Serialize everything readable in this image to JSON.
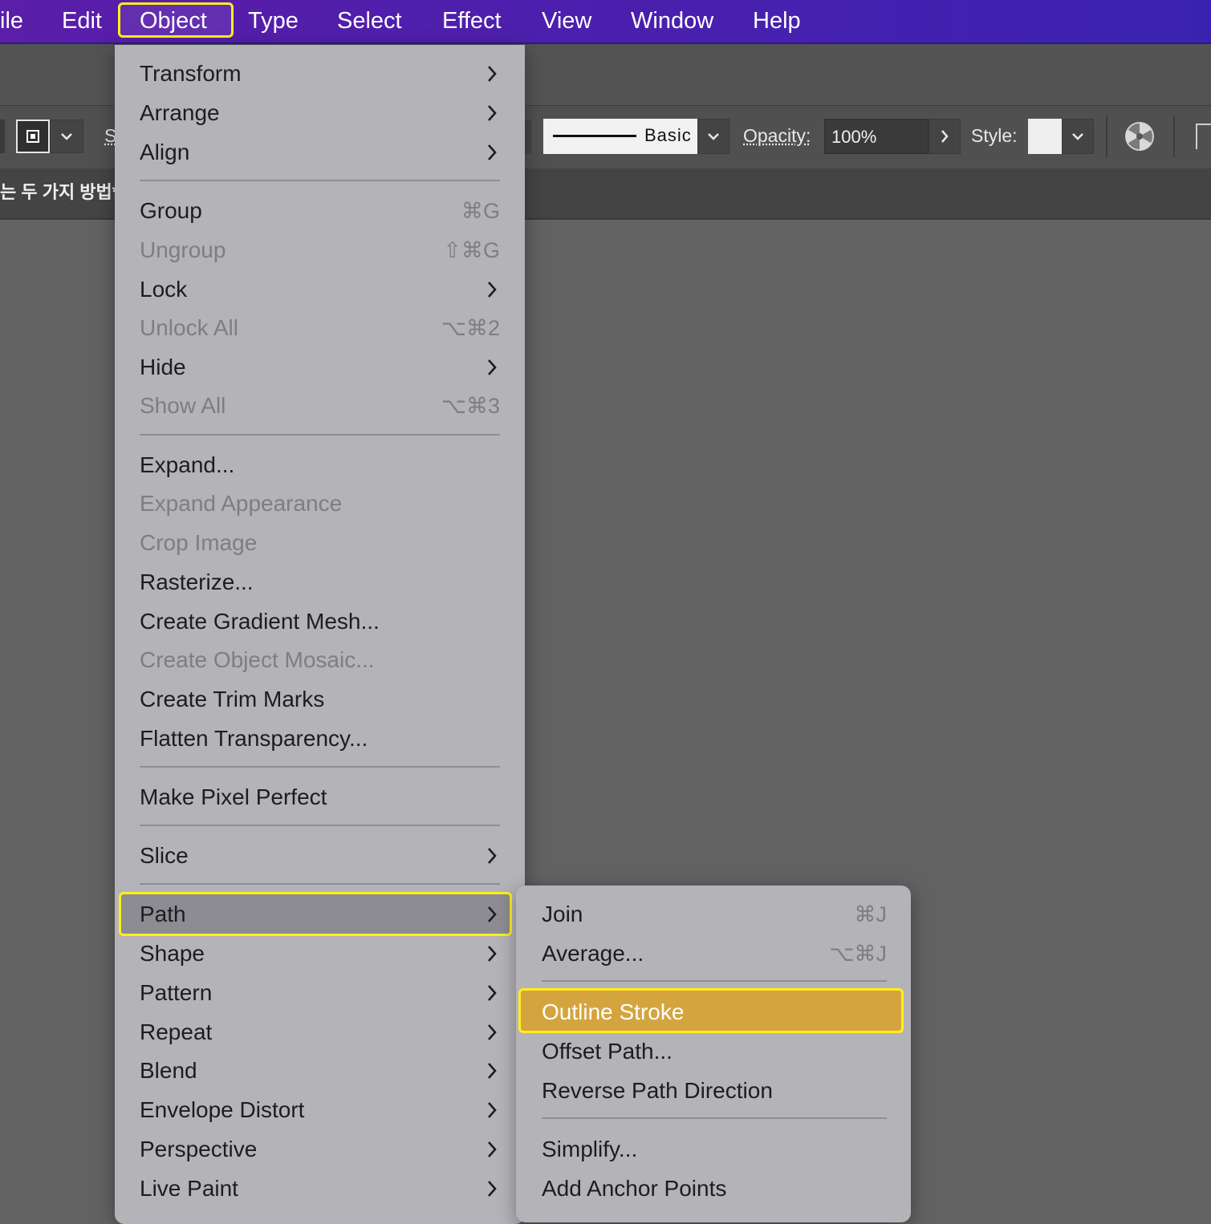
{
  "menubar": {
    "items": [
      {
        "label": "ile"
      },
      {
        "label": "Edit"
      },
      {
        "label": "Object"
      },
      {
        "label": "Type"
      },
      {
        "label": "Select"
      },
      {
        "label": "Effect"
      },
      {
        "label": "View"
      },
      {
        "label": "Window"
      },
      {
        "label": "Help"
      }
    ]
  },
  "controlbar": {
    "stroke_partial_label": "S",
    "brush_label": "Basic",
    "opacity_label": "Opacity:",
    "opacity_value": "100%",
    "style_label": "Style:"
  },
  "document": {
    "tab_title": "는 두 가지 방법*"
  },
  "object_menu": {
    "items": [
      {
        "label": "Transform",
        "submenu": true
      },
      {
        "label": "Arrange",
        "submenu": true
      },
      {
        "label": "Align",
        "submenu": true
      },
      {
        "label": "Group",
        "shortcut": "⌘G"
      },
      {
        "label": "Ungroup",
        "shortcut": "⇧⌘G",
        "disabled": true
      },
      {
        "label": "Lock",
        "submenu": true
      },
      {
        "label": "Unlock All",
        "shortcut": "⌥⌘2",
        "disabled": true
      },
      {
        "label": "Hide",
        "submenu": true
      },
      {
        "label": "Show All",
        "shortcut": "⌥⌘3",
        "disabled": true
      },
      {
        "label": "Expand..."
      },
      {
        "label": "Expand Appearance",
        "disabled": true
      },
      {
        "label": "Crop Image",
        "disabled": true
      },
      {
        "label": "Rasterize..."
      },
      {
        "label": "Create Gradient Mesh..."
      },
      {
        "label": "Create Object Mosaic...",
        "disabled": true
      },
      {
        "label": "Create Trim Marks"
      },
      {
        "label": "Flatten Transparency..."
      },
      {
        "label": "Make Pixel Perfect"
      },
      {
        "label": "Slice",
        "submenu": true
      },
      {
        "label": "Path",
        "submenu": true,
        "highlighted": true
      },
      {
        "label": "Shape",
        "submenu": true
      },
      {
        "label": "Pattern",
        "submenu": true
      },
      {
        "label": "Repeat",
        "submenu": true
      },
      {
        "label": "Blend",
        "submenu": true
      },
      {
        "label": "Envelope Distort",
        "submenu": true
      },
      {
        "label": "Perspective",
        "submenu": true
      },
      {
        "label": "Live Paint",
        "submenu": true
      }
    ]
  },
  "path_submenu": {
    "items": [
      {
        "label": "Join",
        "shortcut": "⌘J"
      },
      {
        "label": "Average...",
        "shortcut": "⌥⌘J"
      },
      {
        "label": "Outline Stroke",
        "highlighted": true
      },
      {
        "label": "Offset Path..."
      },
      {
        "label": "Reverse Path Direction"
      },
      {
        "label": "Simplify..."
      },
      {
        "label": "Add Anchor Points"
      }
    ]
  },
  "colors": {
    "menubar_start": "#5a1ea8",
    "menubar_end": "#3a22b0",
    "highlight_border": "#ffef1a",
    "selected_item": "#d4a53e",
    "menu_bg": "#b4b3b8"
  }
}
